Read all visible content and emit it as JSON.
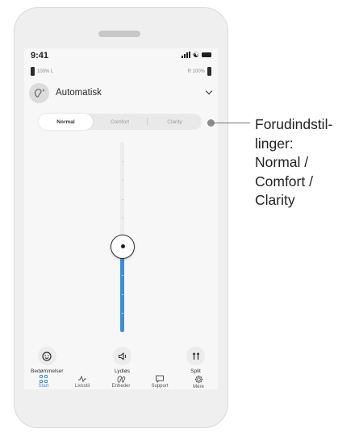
{
  "status": {
    "time": "9:41"
  },
  "battery": {
    "left_label": "100% L",
    "right_label": "R 100%"
  },
  "program": {
    "name": "Automatisk"
  },
  "presets": [
    {
      "label": "Normal",
      "active": true
    },
    {
      "label": "Comfort",
      "active": false
    },
    {
      "label": "Clarity",
      "active": false
    }
  ],
  "volume": {
    "level": 0.45
  },
  "actions": [
    {
      "label": "Bedømmelser",
      "icon": "smiley-icon"
    },
    {
      "label": "Lydløs",
      "icon": "speaker-mute-icon"
    },
    {
      "label": "Split",
      "icon": "split-icon"
    }
  ],
  "tabs": [
    {
      "label": "Start",
      "icon": "grid-icon",
      "active": true
    },
    {
      "label": "Livsstil",
      "icon": "pulse-icon",
      "active": false
    },
    {
      "label": "Enheder",
      "icon": "hearing-aids-icon",
      "active": false
    },
    {
      "label": "Support",
      "icon": "chat-icon",
      "active": false
    },
    {
      "label": "Mere",
      "icon": "gear-icon",
      "active": false
    }
  ],
  "callout": {
    "lines": [
      "Forudindstil-",
      "linger:",
      "Normal /",
      "Comfort /",
      "Clarity"
    ]
  },
  "colors": {
    "accent": "#3b8fd6",
    "phone_bg": "#efefef"
  }
}
